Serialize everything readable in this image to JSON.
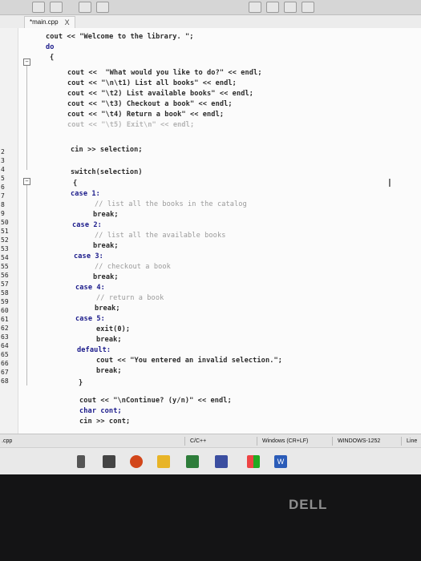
{
  "tab": {
    "title": "*main.cpp",
    "close": "X"
  },
  "line_numbers": [
    "2",
    "3",
    "4",
    "5",
    "6",
    "7",
    "8",
    "9",
    "50",
    "51",
    "52",
    "53",
    "54",
    "55",
    "56",
    "57",
    "58",
    "59",
    "60",
    "61",
    "62",
    "63",
    "64",
    "65",
    "66",
    "67",
    "68"
  ],
  "code_lines": {
    "l01": "cout << \"Welcome to the library. \";",
    "l02": "do",
    "l03": "{",
    "l04": "cout <<  \"What would you like to do?\" << endl;",
    "l05": "cout << \"\\n\\t1) List all books\" << endl;",
    "l06": "cout << \"\\t2) List available books\" << endl;",
    "l07": "cout << \"\\t3) Checkout a book\" << endl;",
    "l08": "cout << \"\\t4) Return a book\" << endl;",
    "l09": "cout << \"\\t5) Exit\\n\" << endl;",
    "l10": "cin >> selection;",
    "l11": "switch(selection)",
    "l12": "{",
    "l13": "case 1:",
    "l14": "// list all the books in the catalog",
    "l15": "break;",
    "l16": "case 2:",
    "l17": "// list all the available books",
    "l18": "break;",
    "l19": "case 3:",
    "l20": "// checkout a book",
    "l21": "break;",
    "l22": "case 4:",
    "l23": "// return a book",
    "l24": "break;",
    "l25": "case 5:",
    "l26": "exit(0);",
    "l27": "break;",
    "l28": "default:",
    "l29": "cout << \"You entered an invalid selection.\";",
    "l30": "break;",
    "l31": "}",
    "l32": "cout << \"\\nContinue? (y/n)\" << endl;",
    "l33": "char cont;",
    "l34": "cin >> cont;"
  },
  "statusbar": {
    "file": ".cpp",
    "language": "C/C++",
    "line_endings": "Windows (CR+LF)",
    "encoding": "WINDOWS-1252",
    "mode": "Line"
  },
  "taskbar": {
    "app_label": "W"
  },
  "monitor": {
    "brand": "DELL"
  }
}
